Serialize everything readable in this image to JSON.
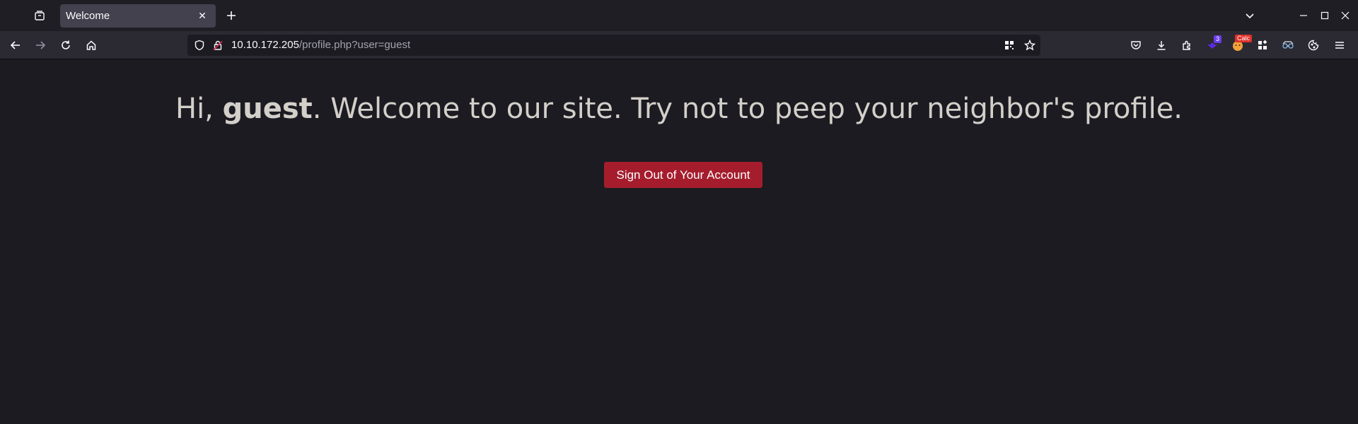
{
  "browser": {
    "tab": {
      "title": "Welcome",
      "close_glyph": "✕"
    },
    "new_tab_glyph": "+",
    "url": {
      "host": "10.10.172.205",
      "path": "/profile.php?user=guest"
    },
    "extensions": {
      "badge_count": "3",
      "calc_label": "Calc"
    }
  },
  "page": {
    "greeting_prefix": "Hi, ",
    "username": "guest",
    "greeting_suffix": ". Welcome to our site. Try not to peep your neighbor's profile.",
    "signout_label": "Sign Out of Your Account"
  },
  "colors": {
    "background": "#1c1b22",
    "text": "#d3cfc9",
    "button": "#a51d2d"
  },
  "icons": [
    "tab-list-icon",
    "close-icon",
    "plus-icon",
    "chevron-down-icon",
    "minimize-icon",
    "maximize-icon",
    "window-close-icon",
    "back-arrow-icon",
    "forward-arrow-icon",
    "reload-icon",
    "home-icon",
    "shield-icon",
    "lock-insecure-icon",
    "qr-code-icon",
    "bookmark-star-icon",
    "pocket-icon",
    "download-icon",
    "extensions-icon",
    "purple-extension-icon",
    "calc-extension-icon",
    "grid-extension-icon",
    "glasses-extension-icon",
    "cookie-extension-icon",
    "hamburger-menu-icon"
  ]
}
